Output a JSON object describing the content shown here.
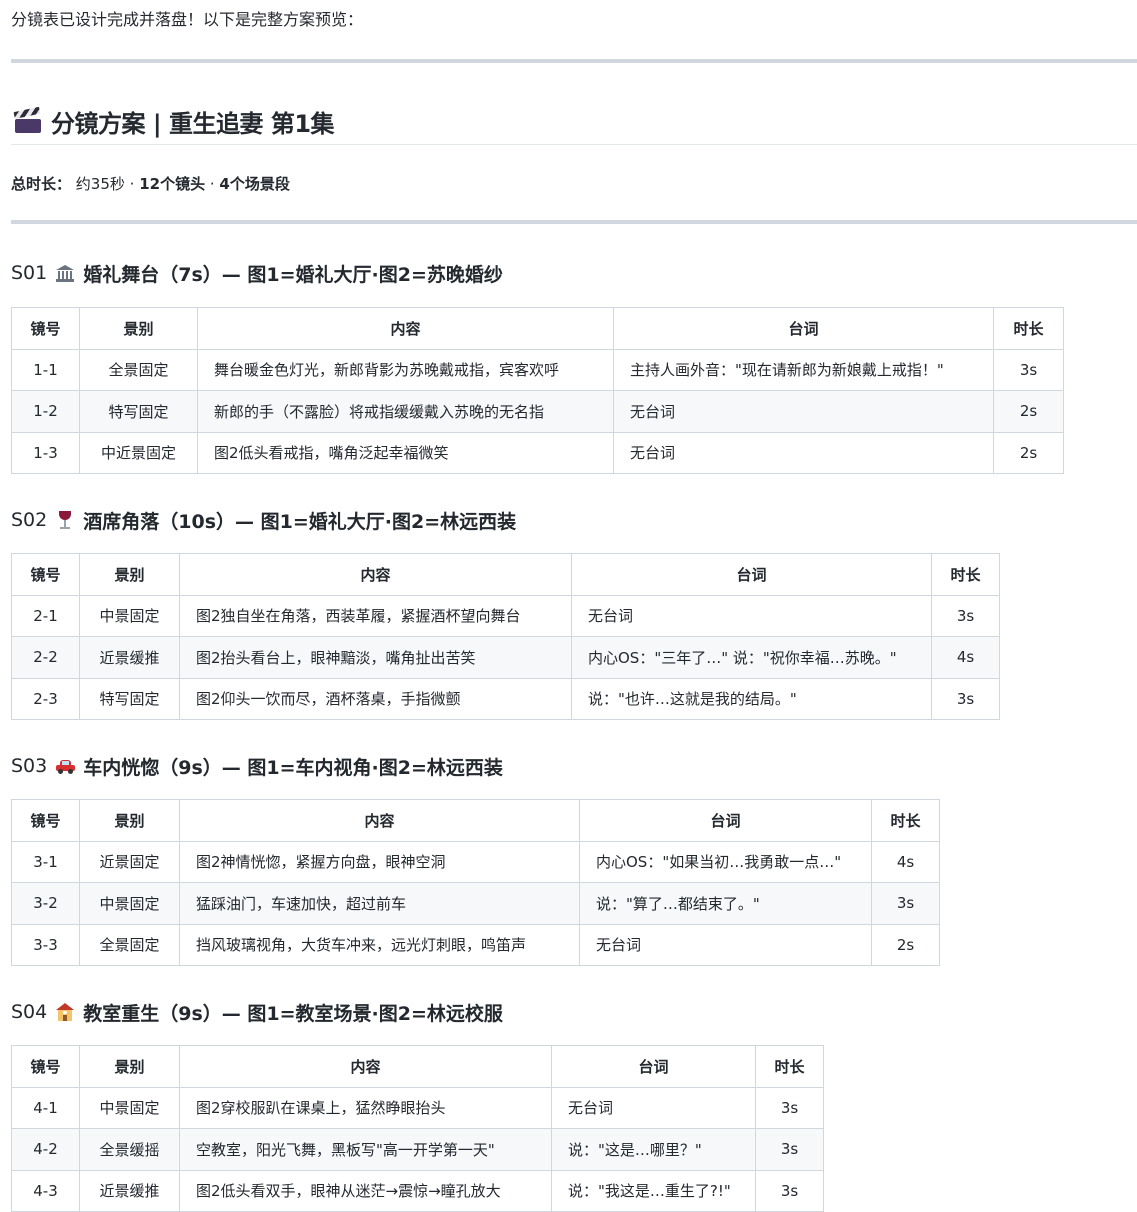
{
  "intro": "分镜表已设计完成并落盘！以下是完整方案预览：",
  "title": "分镜方案 | 重生追妻 第1集",
  "summary": {
    "label": "总时长：",
    "duration": "约35秒 · ",
    "shots": "12个镜头",
    "sep": " · ",
    "scenes": "4个场景段"
  },
  "table_headers": [
    "镜号",
    "景别",
    "内容",
    "台词",
    "时长"
  ],
  "sections": [
    {
      "code": "S01",
      "icon": "classical-building-icon",
      "title": "婚礼舞台（7s）— 图1=婚礼大厅·图2=苏晚婚纱",
      "rows": [
        [
          "1-1",
          "全景固定",
          "舞台暖金色灯光，新郎背影为苏晚戴戒指，宾客欢呼",
          "主持人画外音：\"现在请新郎为新娘戴上戒指！\"",
          "3s"
        ],
        [
          "1-2",
          "特写固定",
          "新郎的手（不露脸）将戒指缓缓戴入苏晚的无名指",
          "无台词",
          "2s"
        ],
        [
          "1-3",
          "中近景固定",
          "图2低头看戒指，嘴角泛起幸福微笑",
          "无台词",
          "2s"
        ]
      ]
    },
    {
      "code": "S02",
      "icon": "wine-glass-icon",
      "title": "酒席角落（10s）— 图1=婚礼大厅·图2=林远西装",
      "rows": [
        [
          "2-1",
          "中景固定",
          "图2独自坐在角落，西装革履，紧握酒杯望向舞台",
          "无台词",
          "3s"
        ],
        [
          "2-2",
          "近景缓推",
          "图2抬头看台上，眼神黯淡，嘴角扯出苦笑",
          "内心OS：\"三年了…\" 说：\"祝你幸福…苏晚。\"",
          "4s"
        ],
        [
          "2-3",
          "特写固定",
          "图2仰头一饮而尽，酒杯落桌，手指微颤",
          "说：\"也许…这就是我的结局。\"",
          "3s"
        ]
      ]
    },
    {
      "code": "S03",
      "icon": "car-icon",
      "title": "车内恍惚（9s）— 图1=车内视角·图2=林远西装",
      "rows": [
        [
          "3-1",
          "近景固定",
          "图2神情恍惚，紧握方向盘，眼神空洞",
          "内心OS：\"如果当初…我勇敢一点…\"",
          "4s"
        ],
        [
          "3-2",
          "中景固定",
          "猛踩油门，车速加快，超过前车",
          "说：\"算了…都结束了。\"",
          "3s"
        ],
        [
          "3-3",
          "全景固定",
          "挡风玻璃视角，大货车冲来，远光灯刺眼，鸣笛声",
          "无台词",
          "2s"
        ]
      ]
    },
    {
      "code": "S04",
      "icon": "school-icon",
      "title": "教室重生（9s）— 图1=教室场景·图2=林远校服",
      "rows": [
        [
          "4-1",
          "中景固定",
          "图2穿校服趴在课桌上，猛然睁眼抬头",
          "无台词",
          "3s"
        ],
        [
          "4-2",
          "全景缓摇",
          "空教室，阳光飞舞，黑板写\"高一开学第一天\"",
          "说：\"这是…哪里？\"",
          "3s"
        ],
        [
          "4-3",
          "近景缓推",
          "图2低头看双手，眼神从迷茫→震惊→瞳孔放大",
          "说：\"我这是…重生了?!\"",
          "3s"
        ]
      ]
    }
  ]
}
